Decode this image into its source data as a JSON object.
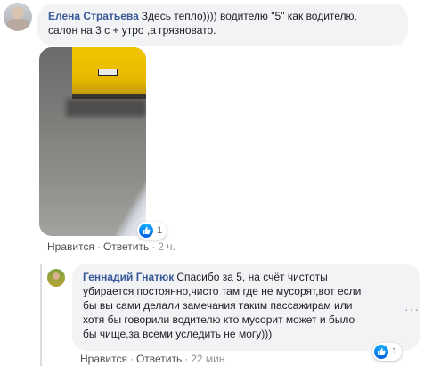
{
  "comments": [
    {
      "author": "Елена Стратьева",
      "text_line1": "Здесь тепло)))) водителю \"5\" как водителю,",
      "text_line2": "салон на 3 с + утро ,а грязновато.",
      "reaction_count": "1",
      "like_label": "Нравится",
      "reply_label": "Ответить",
      "time": "2 ч.",
      "reaction_icon": "like-icon"
    },
    {
      "author": "Геннадий Гнатюк",
      "text_line1": "Спасибо за 5, на счёт чистоты",
      "text_line2": "убирается постоянно,чисто там где не мусорят,вот если",
      "text_line3": "бы вы сами делали замечания таким пассажирам или",
      "text_line4": "хотя бы говорили водителю кто мусорит может и было",
      "text_line5": "бы чище,за всеми уследить не могу)))",
      "reaction_count": "1",
      "like_label": "Нравится",
      "reply_label": "Ответить",
      "time": "22 мин.",
      "reaction_icon": "like-icon"
    }
  ],
  "more_label": "···",
  "separator": "·",
  "colors": {
    "author": "#385898",
    "bubble": "#f2f3f5",
    "like_blue": "#0062df",
    "meta_gray": "#90949c"
  }
}
